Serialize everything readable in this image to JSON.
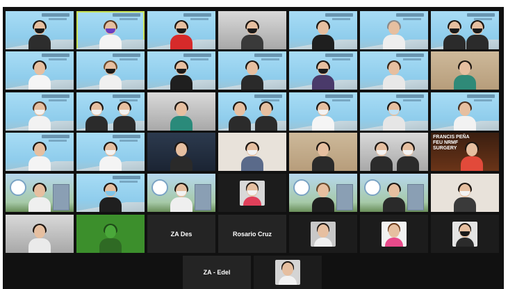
{
  "name_tiles": {
    "za_des": "ZA Des",
    "rosario_cruz": "Rosario Cruz",
    "za_edel": "ZA - Edel"
  },
  "background_labels": {
    "feu_banner_line1": "FRANCIS  PEÑA",
    "feu_banner_line2": "FEU NRMF",
    "feu_banner_line3": "SURGERY"
  },
  "colors": {
    "meeting_background": "#111111",
    "name_tile_background": "#242424",
    "active_speaker_outline": "#c9e356"
  }
}
